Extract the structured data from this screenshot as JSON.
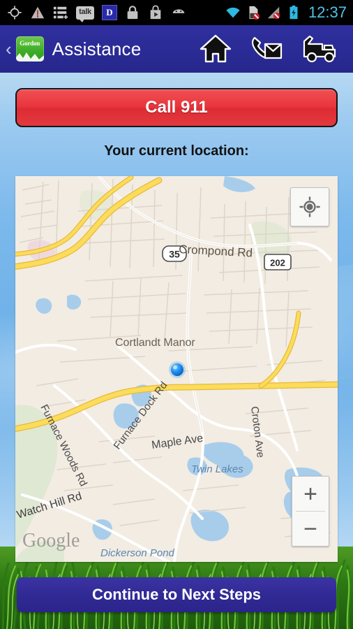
{
  "statusbar": {
    "time": "12:37",
    "left_icons": [
      {
        "name": "gps-crosshair-icon"
      },
      {
        "name": "warning-triangle-icon"
      },
      {
        "name": "task-list-icon"
      },
      {
        "name": "talk-icon",
        "label": "talk"
      },
      {
        "name": "app-badge-icon",
        "label": "D"
      },
      {
        "name": "lock-icon"
      },
      {
        "name": "play-store-icon"
      },
      {
        "name": "android-robot-icon"
      }
    ],
    "right_icons": [
      {
        "name": "wifi-icon"
      },
      {
        "name": "sd-card-error-icon"
      },
      {
        "name": "signal-error-icon"
      },
      {
        "name": "battery-charging-icon"
      }
    ]
  },
  "appbar": {
    "back_label": "‹",
    "brand_name": "Gordon",
    "title": "Assistance",
    "actions": [
      {
        "name": "home-icon",
        "label": "Home"
      },
      {
        "name": "contact-icon",
        "label": "Contact"
      },
      {
        "name": "tow-truck-icon",
        "label": "Tow Truck"
      }
    ]
  },
  "main": {
    "emergency_button_label": "Call 911",
    "location_caption": "Your current location:",
    "continue_button_label": "Continue to Next Steps"
  },
  "map": {
    "attribution": "Google",
    "my_location_label": "My Location",
    "zoom_in_label": "+",
    "zoom_out_label": "−",
    "place_labels": [
      {
        "text": "Crompond Rd"
      },
      {
        "text": "Cortlandt Manor"
      },
      {
        "text": "Furnace Woods Rd"
      },
      {
        "text": "Furnace Dock Rd"
      },
      {
        "text": "Maple Ave"
      },
      {
        "text": "Croton Ave"
      },
      {
        "text": "Watch Hill Rd"
      },
      {
        "text": "Twin Lakes"
      },
      {
        "text": "Dickerson Pond"
      }
    ],
    "route_shields": [
      {
        "text": "35"
      },
      {
        "text": "202"
      }
    ]
  },
  "colors": {
    "brand_blue": "#2b2b96",
    "emergency_red": "#e2343c",
    "continue_blue": "#312a95",
    "status_accent": "#4fc3e8",
    "map_land": "#f2ece3",
    "map_water": "#a8cdeb",
    "map_highway": "#f7d24b",
    "location_dot": "#1a8cf0"
  }
}
